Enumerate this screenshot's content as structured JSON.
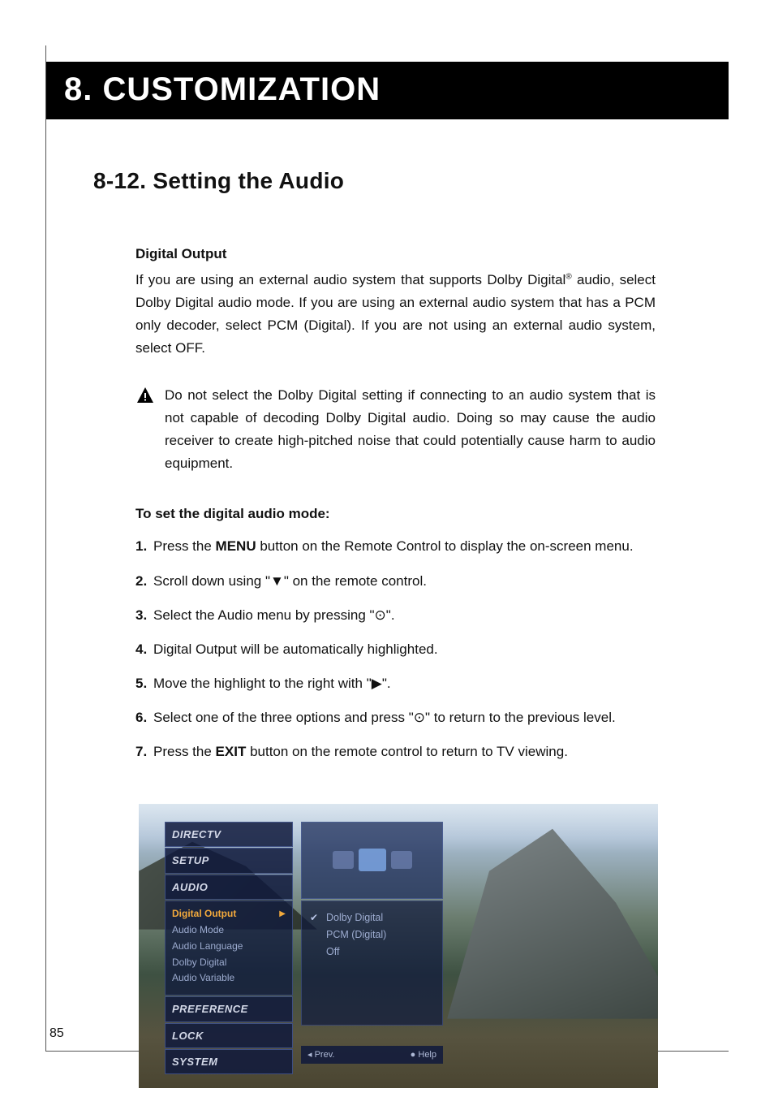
{
  "chapter_title": "8. CUSTOMIZATION",
  "section_title": "8-12. Setting the Audio",
  "digital_output": {
    "heading": "Digital Output",
    "text_a": "If you are using an external audio system that supports Dolby Digital",
    "sup": "®",
    "text_b": " audio, select Dolby Digital audio mode.  If you are using an external audio system that has a PCM only decoder, select  PCM (Digital).  If you are not using an external audio system, select OFF."
  },
  "warning": "Do not select the Dolby Digital setting if connecting to an audio system that is not capable of decoding Dolby Digital audio. Doing so may cause the audio receiver to create high-pitched noise that could potentially cause harm to audio equipment.",
  "instructions_heading": "To set the digital audio mode:",
  "steps": {
    "s1a": "Press the ",
    "s1b": "MENU",
    "s1c": " button on the Remote Control to display the on-screen menu.",
    "s2a": "Scroll down using \"",
    "s2b": "▼",
    "s2c": "\" on the remote control.",
    "s3a": "Select the Audio menu by pressing \"",
    "s3b": "⊙",
    "s3c": "\".",
    "s4": "Digital Output will be automatically highlighted.",
    "s5a": "Move the highlight to the right with \"",
    "s5b": "▶",
    "s5c": "\".",
    "s6a": "Select one of the three options and press \"",
    "s6b": "⊙",
    "s6c": "\" to return to the previous level.",
    "s7a": "Press the ",
    "s7b": "EXIT",
    "s7c": " button on the remote control to return to TV viewing."
  },
  "osd": {
    "breadcrumb": [
      "DIRECTV",
      "SETUP",
      "AUDIO"
    ],
    "menu_items": {
      "selected": "Digital Output",
      "others": [
        "Audio Mode",
        "Audio Language",
        "Dolby Digital",
        "Audio Variable"
      ]
    },
    "tail_items": [
      "PREFERENCE",
      "LOCK",
      "SYSTEM"
    ],
    "options": {
      "selected": "Dolby Digital",
      "rest": [
        "PCM (Digital)",
        "Off"
      ]
    },
    "footer": {
      "prev": "Prev.",
      "help": "Help"
    }
  },
  "page_number": "85",
  "icons": {
    "prev_glyph": "◂",
    "help_glyph": "●"
  }
}
